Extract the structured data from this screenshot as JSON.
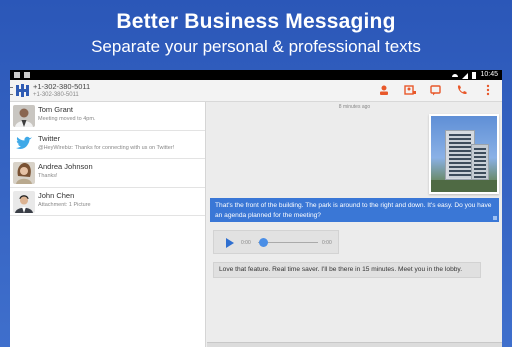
{
  "promo": {
    "title": "Better Business Messaging",
    "subtitle": "Separate your personal & professional texts"
  },
  "statusbar": {
    "time": "10:45"
  },
  "appbar": {
    "phone_primary": "+1-302-380-5011",
    "phone_secondary": "+1-302-380-5011",
    "accent": "#e8582a"
  },
  "conversations": [
    {
      "name": "Tom Grant",
      "preview": "Meeting moved to 4pm."
    },
    {
      "name": "Twitter",
      "preview": "@HeyWirebiz: Thanks for connecting with us on Twitter!"
    },
    {
      "name": "Andrea Johnson",
      "preview": "Thanks!"
    },
    {
      "name": "John Chen",
      "preview": "Attachment: 1 Picture"
    }
  ],
  "thread": {
    "timestamp": "8 minutes ago",
    "outgoing_message": "That's the front of the building. The park is around to the right and down. It's easy. Do you have an agenda planned for the meeting?",
    "audio": {
      "elapsed": "0:00",
      "duration": "0:00"
    },
    "incoming_message": "Love that feature. Real time saver. I'll be there in 15 minutes. Meet you in the lobby."
  }
}
